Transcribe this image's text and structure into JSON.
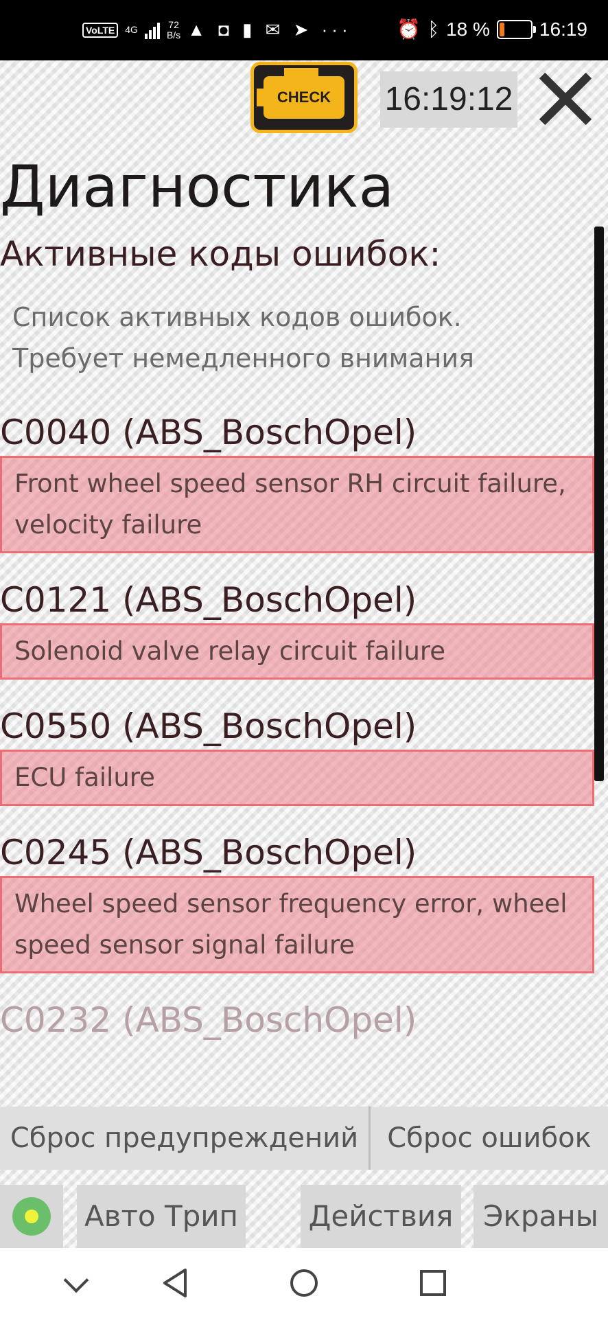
{
  "status_bar": {
    "volte": "VoLTE",
    "network": "4G",
    "speed_value": "72",
    "speed_unit": "B/s",
    "battery_percent": "18 %",
    "time": "16:19"
  },
  "header": {
    "check_label": "CHECK",
    "clock": "16:19:12"
  },
  "page": {
    "title": "Диагностика",
    "subtitle": "Активные коды ошибок:",
    "description": "Список активных кодов ошибок. Требует немедленного внимания"
  },
  "codes": [
    {
      "code": "C0040 (ABS_BoschOpel)",
      "description": "Front wheel speed sensor RH circuit failure, velocity failure"
    },
    {
      "code": "C0121 (ABS_BoschOpel)",
      "description": "Solenoid valve relay circuit failure"
    },
    {
      "code": "C0550 (ABS_BoschOpel)",
      "description": "ECU failure"
    },
    {
      "code": "C0245 (ABS_BoschOpel)",
      "description": "Wheel speed sensor frequency error, wheel speed sensor signal failure"
    },
    {
      "code": "C0232 (ABS_BoschOpel)",
      "description": ""
    }
  ],
  "bottom_buttons": {
    "reset_warnings": "Сброс предупреждений",
    "reset_errors": "Сброс ошибок"
  },
  "toolbar": {
    "trip": "Авто Трип",
    "actions": "Действия",
    "screens": "Экраны"
  },
  "colors": {
    "error_fill": "#ec828c",
    "error_border": "#ec6d76",
    "check_yellow": "#f3b51a",
    "led_green": "#6cbf6a"
  }
}
